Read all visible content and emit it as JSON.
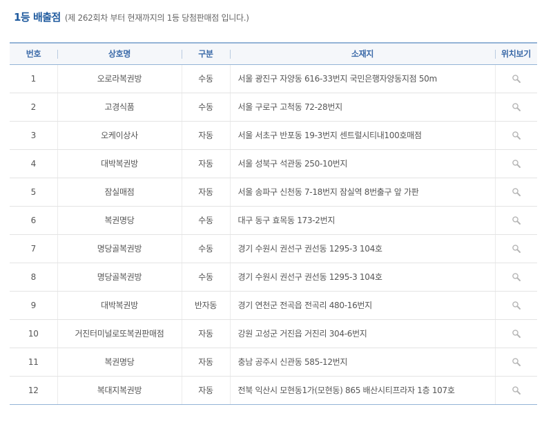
{
  "header": {
    "title": "1등 배출점",
    "subtitle": "(제 262회차 부터 현재까지의 1등 당첨판매점 입니다.)"
  },
  "table": {
    "columns": [
      "번호",
      "상호명",
      "구분",
      "소재지",
      "위치보기"
    ],
    "rows": [
      {
        "no": "1",
        "name": "오로라복권방",
        "type": "수동",
        "address": "서울 광진구 자양동 616-33번지 국민은행자양동지점 50m"
      },
      {
        "no": "2",
        "name": "고경식품",
        "type": "수동",
        "address": "서울 구로구 고척동 72-28번지"
      },
      {
        "no": "3",
        "name": "오케이상사",
        "type": "자동",
        "address": "서울 서초구 반포동 19-3번지 센트럴시티내100호매점"
      },
      {
        "no": "4",
        "name": "대박복권방",
        "type": "자동",
        "address": "서울 성북구 석관동 250-10번지"
      },
      {
        "no": "5",
        "name": "잠실매점",
        "type": "자동",
        "address": "서울 송파구 신천동 7-18번지 잠실역 8번출구 앞 가판"
      },
      {
        "no": "6",
        "name": "복권명당",
        "type": "수동",
        "address": "대구 동구 효목동 173-2번지"
      },
      {
        "no": "7",
        "name": "명당골복권방",
        "type": "수동",
        "address": "경기 수원시 권선구 권선동 1295-3 104호"
      },
      {
        "no": "8",
        "name": "명당골복권방",
        "type": "수동",
        "address": "경기 수원시 권선구 권선동 1295-3 104호"
      },
      {
        "no": "9",
        "name": "대박복권방",
        "type": "반자동",
        "address": "경기 연천군 전곡읍 전곡리 480-16번지"
      },
      {
        "no": "10",
        "name": "거진터미널로또복권판매점",
        "type": "자동",
        "address": "강원 고성군 거진읍 거진리 304-6번지"
      },
      {
        "no": "11",
        "name": "복권명당",
        "type": "자동",
        "address": "충남 공주시 신관동 585-12번지"
      },
      {
        "no": "12",
        "name": "복대지복권방",
        "type": "자동",
        "address": "전북 익산시 모현동1가(모현동) 865 배산시티프라자 1층 107호"
      }
    ]
  },
  "icons": {
    "location": "magnifier-icon"
  },
  "colors": {
    "title": "#1f5a9e",
    "header_text": "#3b6aa8",
    "header_border": "#93b3d6"
  }
}
